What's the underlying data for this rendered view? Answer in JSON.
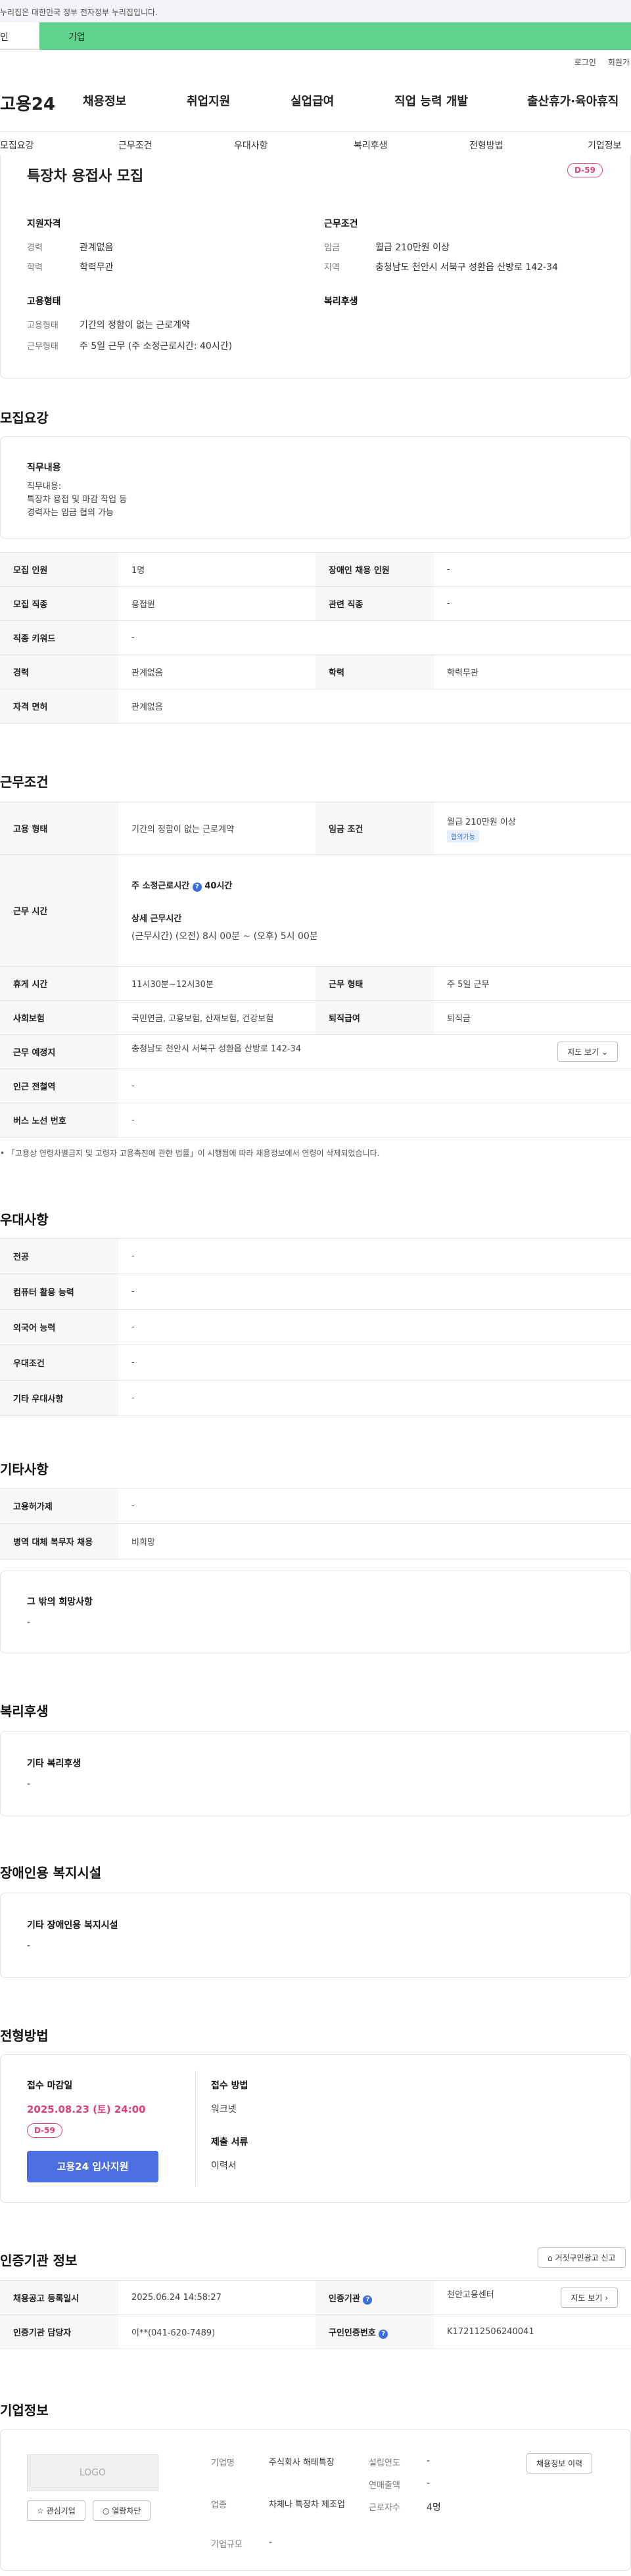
{
  "gov_notice": "누리집은 대한민국 정부 전자정부 누리집입니다.",
  "top_tabs": [
    "인",
    "기업"
  ],
  "util": [
    "로그인",
    "회원가"
  ],
  "logo": "고용24",
  "gnb": [
    "채용정보",
    "취업지원",
    "실업급여",
    "직업 능력 개발",
    "출산휴가·육아휴직"
  ],
  "subnav": [
    "모집요강",
    "근무조건",
    "우대사항",
    "복리후생",
    "전형방법",
    "기업정보"
  ],
  "summary": {
    "title": "특장차 용접사 모집",
    "dday": "D-59",
    "qual_title": "지원자격",
    "career_label": "경력",
    "career_value": "관계없음",
    "edu_label": "학력",
    "edu_value": "학력무관",
    "cond_title": "근무조건",
    "wage_label": "임금",
    "wage_value": "월급 210만원 이상",
    "region_label": "지역",
    "region_value": "충청남도 천안시 서북구 성환읍 산방로 142-34",
    "emp_title": "고용형태",
    "emp_type_label": "고용형태",
    "emp_type_value": "기간의 정함이 없는 근로계약",
    "work_type_label": "근무형태",
    "work_type_value": "주 5일 근무 (주 소정근로시간: 40시간)",
    "welfare_title": "복리후생"
  },
  "recruit": {
    "title": "모집요강",
    "duty_title": "직무내용",
    "duty_lines": [
      "직무내용:",
      "특장차 용접 및 마감 작업 등",
      "경력자는 임금 협의 가능"
    ],
    "rows": [
      [
        "모집 인원",
        "1명",
        "장애인 채용 인원",
        "-"
      ],
      [
        "모집 직종",
        "용접원",
        "관련 직종",
        "-"
      ],
      [
        "직종 키워드",
        "-",
        "",
        ""
      ],
      [
        "경력",
        "관계없음",
        "학력",
        "학력무관"
      ],
      [
        "자격 면허",
        "관계없음",
        "",
        ""
      ]
    ]
  },
  "work": {
    "title": "근무조건",
    "emp_label": "고용 형태",
    "emp_value": "기간의 정함이 없는 근로계약",
    "wage_label": "임금 조건",
    "wage_value": "월급 210만원 이상",
    "wage_tag": "협의가능",
    "time_label": "근무 시간",
    "weekly_label": "주 소정근로시간",
    "weekly_value": "40시간",
    "detail_label": "상세 근무시간",
    "detail_value": "(근무시간) (오전) 8시 00분 ~ (오후) 5시 00분",
    "rest_label": "휴게 시간",
    "rest_value": "11시30분~12시30분",
    "form_label": "근무 형태",
    "form_value": "주 5일 근무",
    "ins_label": "사회보험",
    "ins_value": "국민연금, 고용보험, 산재보험, 건강보험",
    "sev_label": "퇴직급여",
    "sev_value": "퇴직금",
    "place_label": "근무 예정지",
    "place_value": "충청남도 천안시 서북구 성환읍 산방로 142-34",
    "map_btn": "지도 보기",
    "subway_label": "인근 전철역",
    "subway_value": "-",
    "bus_label": "버스 노선 번호",
    "bus_value": "-",
    "note": "「고용상 연령차별금지 및 고령자 고용촉진에 관한 법률」이 시행됨에 따라 채용정보에서 연령이 삭제되었습니다."
  },
  "pref": {
    "title": "우대사항",
    "rows": [
      [
        "전공",
        "-"
      ],
      [
        "컴퓨터 활용 능력",
        "-"
      ],
      [
        "외국어 능력",
        "-"
      ],
      [
        "우대조건",
        "-"
      ],
      [
        "기타 우대사항",
        "-"
      ]
    ]
  },
  "etc": {
    "title": "기타사항",
    "rows": [
      [
        "고용허가제",
        "-"
      ],
      [
        "병역 대체 복무자 채용",
        "비희망"
      ]
    ],
    "wish_title": "그 밖의 희망사항",
    "wish_value": "-"
  },
  "welfare": {
    "title": "복리후생",
    "sub": "기타 복리후생",
    "value": "-"
  },
  "disab": {
    "title": "장애인용 복지시설",
    "sub": "기타 장애인용 복지시설",
    "value": "-"
  },
  "process": {
    "title": "전형방법",
    "deadline_label": "접수 마감일",
    "deadline_value": "2025.08.23 (토) 24:00",
    "dday": "D-59",
    "apply_btn": "고용24 입사지원",
    "method_label": "접수 방법",
    "method_value": "워크넷",
    "docs_label": "제출 서류",
    "docs_value": "이력서"
  },
  "cert": {
    "title": "인증기관 정보",
    "report_btn": "거짓구인광고 신고",
    "reg_label": "채용공고 등록일시",
    "reg_value": "2025.06.24 14:58:27",
    "org_label": "인증기관",
    "org_value": "천안고용센터",
    "detail_btn": "지도 보기",
    "mgr_label": "인증기관 담당자",
    "mgr_value": "이**(041-620-7489)",
    "id_label": "구인인증번호",
    "id_value": "K172112506240041"
  },
  "company": {
    "title": "기업정보",
    "logo_text": "LOGO",
    "fav_btn": "관심기업",
    "block_btn": "열람차단",
    "name_label": "기업명",
    "name_value": "주식회사 해테특장",
    "ind_label": "업종",
    "ind_value": "차체나 특장차 제조업",
    "size_label": "기업규모",
    "size_value": "-",
    "year_label": "설립연도",
    "year_value": "-",
    "sales_label": "연매출액",
    "sales_value": "-",
    "emp_label": "근로자수",
    "emp_value": "4명",
    "history_btn": "채용정보 이력"
  }
}
